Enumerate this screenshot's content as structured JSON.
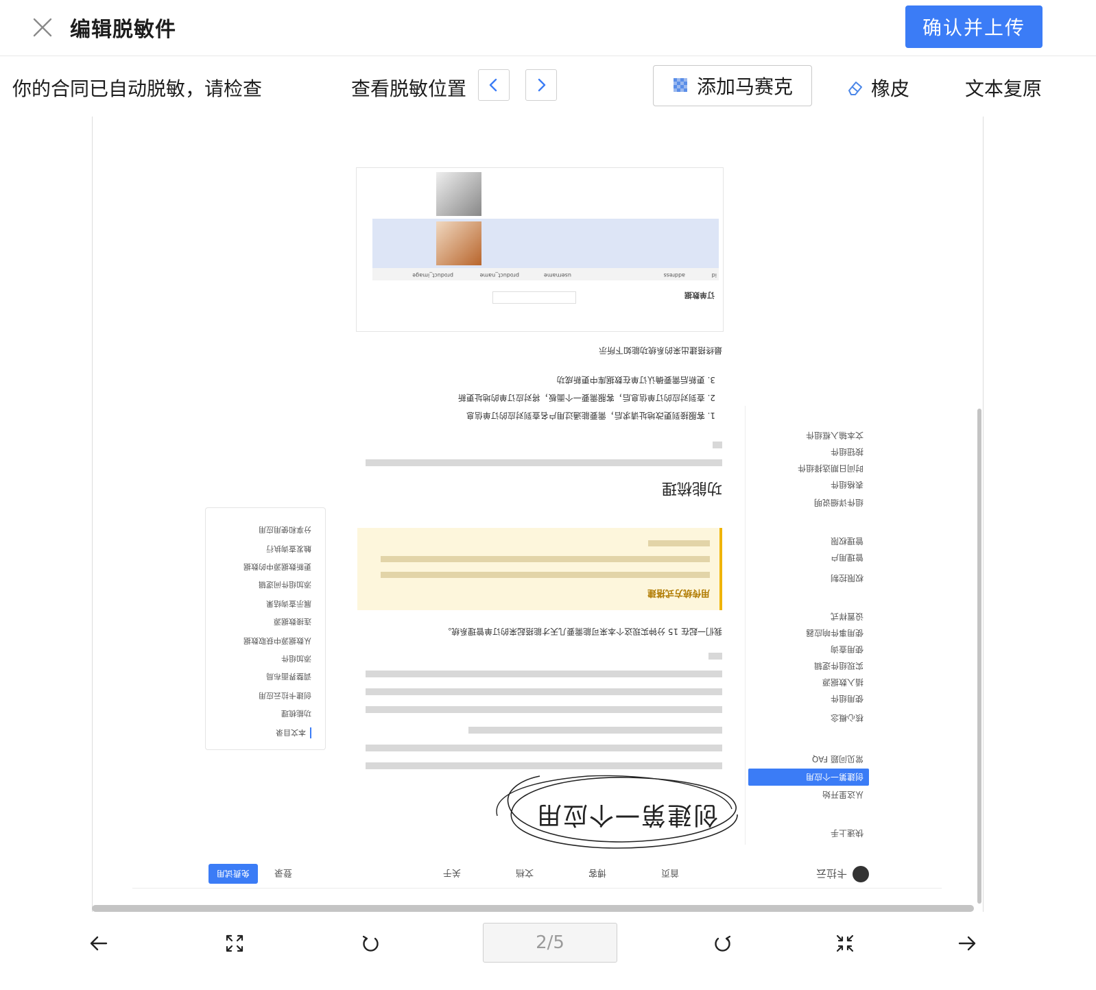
{
  "header": {
    "title": "编辑脱敏件",
    "confirm_label": "确认并上传"
  },
  "toolbar": {
    "notice": "你的合同已自动脱敏，请检查",
    "locate_label": "查看脱敏位置",
    "mosaic_label": "添加马赛克",
    "eraser_label": "橡皮",
    "restore_label": "文本复原"
  },
  "document": {
    "heading": "创建第一个应用",
    "brand": "卡拉云",
    "nav_items": [
      "首页",
      "博客",
      "文档",
      "关于",
      "登录",
      "免费试用"
    ],
    "sidebar_items": [
      "快速上手",
      "从这里开始",
      "创建第一个应用",
      "常见问题 FAQ",
      "核心概念",
      "使用组件",
      "插入数据源",
      "实现组件逻辑",
      "使用查询",
      "使用事件响应器",
      "设置样式",
      "权限控制",
      "管理用户",
      "管理权限",
      "组件详细说明",
      "表格组件",
      "时间日期选择组件",
      "按钮组件",
      "文本输入框组件"
    ],
    "toc_items": [
      "本文目录",
      "功能梳理",
      "创建卡拉云应用",
      "调整界面布局",
      "添加组件",
      "从数据源中获取数据",
      "连接数据源",
      "展示查询结果",
      "添加组件间逻辑",
      "更新数据源中的数据",
      "触发查询执行",
      "分享和使用应用"
    ],
    "section_heading": "功能梳理",
    "callout_title": "用传统方式搭建",
    "paragraph_1": "我们一起在 15 分钟实现这个本来可能需要几天才能搭起来的订单管理系统。",
    "steps": [
      "1. 客服接到更改地址请求后，需要能通过用户名查到对应的订单信息",
      "2. 查到对应的订单信息后，客服需要一个面板，将对应订单的地址更新",
      "3. 更新后需要确认订单在数据库中更新成功"
    ],
    "result_caption": "最终搭建出来的系统功能如下所示",
    "table_title": "订单数据",
    "table_headers": [
      "id",
      "address",
      "username",
      "product_name",
      "product_image"
    ]
  },
  "pager": {
    "current": 2,
    "total": 5,
    "label": "2/5"
  },
  "icons": {
    "close": "close-icon",
    "prev": "chevron-left-icon",
    "next": "chevron-right-icon",
    "mosaic": "mosaic-icon",
    "eraser": "eraser-icon",
    "back": "arrow-left-icon",
    "fit": "fit-screen-icon",
    "rotate_ccw": "rotate-left-icon",
    "rotate_cw": "rotate-right-icon",
    "collapse": "shrink-icon",
    "forward": "arrow-right-icon"
  },
  "colors": {
    "accent": "#3b7cf6",
    "nav_arrow": "#3b7cf6",
    "callout_bg": "#fdf6dc",
    "callout_border": "#f0b400",
    "sidebar_active": "#3b7cf6"
  }
}
